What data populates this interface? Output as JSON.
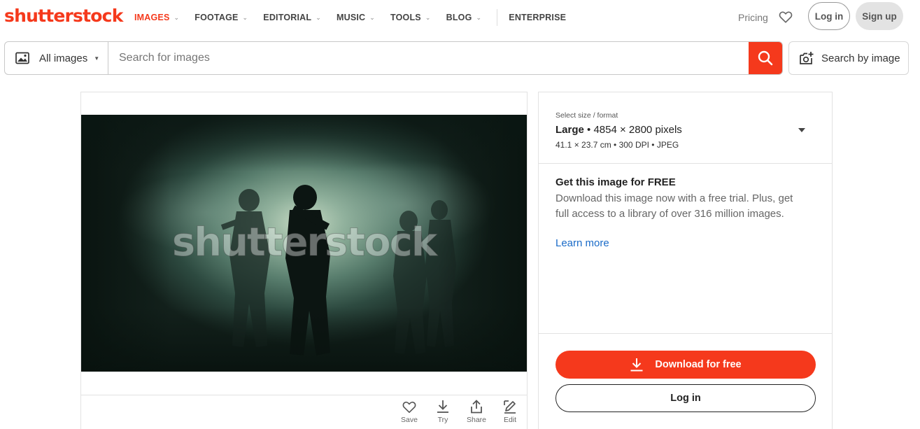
{
  "header": {
    "logo": "shutterstock",
    "nav": [
      {
        "label": "IMAGES",
        "active": true,
        "has_menu": true
      },
      {
        "label": "FOOTAGE",
        "active": false,
        "has_menu": true
      },
      {
        "label": "EDITORIAL",
        "active": false,
        "has_menu": true
      },
      {
        "label": "MUSIC",
        "active": false,
        "has_menu": true
      },
      {
        "label": "TOOLS",
        "active": false,
        "has_menu": true
      },
      {
        "label": "BLOG",
        "active": false,
        "has_menu": true
      },
      {
        "label": "ENTERPRISE",
        "active": false,
        "has_menu": false
      }
    ],
    "pricing": "Pricing",
    "login": "Log in",
    "signup": "Sign up"
  },
  "search": {
    "type_label": "All images",
    "placeholder": "Search for images",
    "value": "",
    "search_by_image": "Search by image"
  },
  "image": {
    "watermark": "shutterstock",
    "tools": [
      {
        "label": "Save",
        "icon": "heart-icon"
      },
      {
        "label": "Try",
        "icon": "download-icon"
      },
      {
        "label": "Share",
        "icon": "share-icon"
      },
      {
        "label": "Edit",
        "icon": "edit-icon"
      }
    ]
  },
  "size": {
    "caption": "Select size / format",
    "name": "Large",
    "pixels": " • 4854 × 2800 pixels",
    "details": "41.1 × 23.7 cm • 300 DPI • JPEG"
  },
  "offer": {
    "title": "Get this image for FREE",
    "text": "Download this image now with a free trial. Plus, get full access to a library of over 316 million images.",
    "learn_more": "Learn more"
  },
  "actions": {
    "download": "Download for free",
    "login": "Log in"
  },
  "colors": {
    "brand": "#f5391c",
    "link": "#1a6bc8"
  }
}
